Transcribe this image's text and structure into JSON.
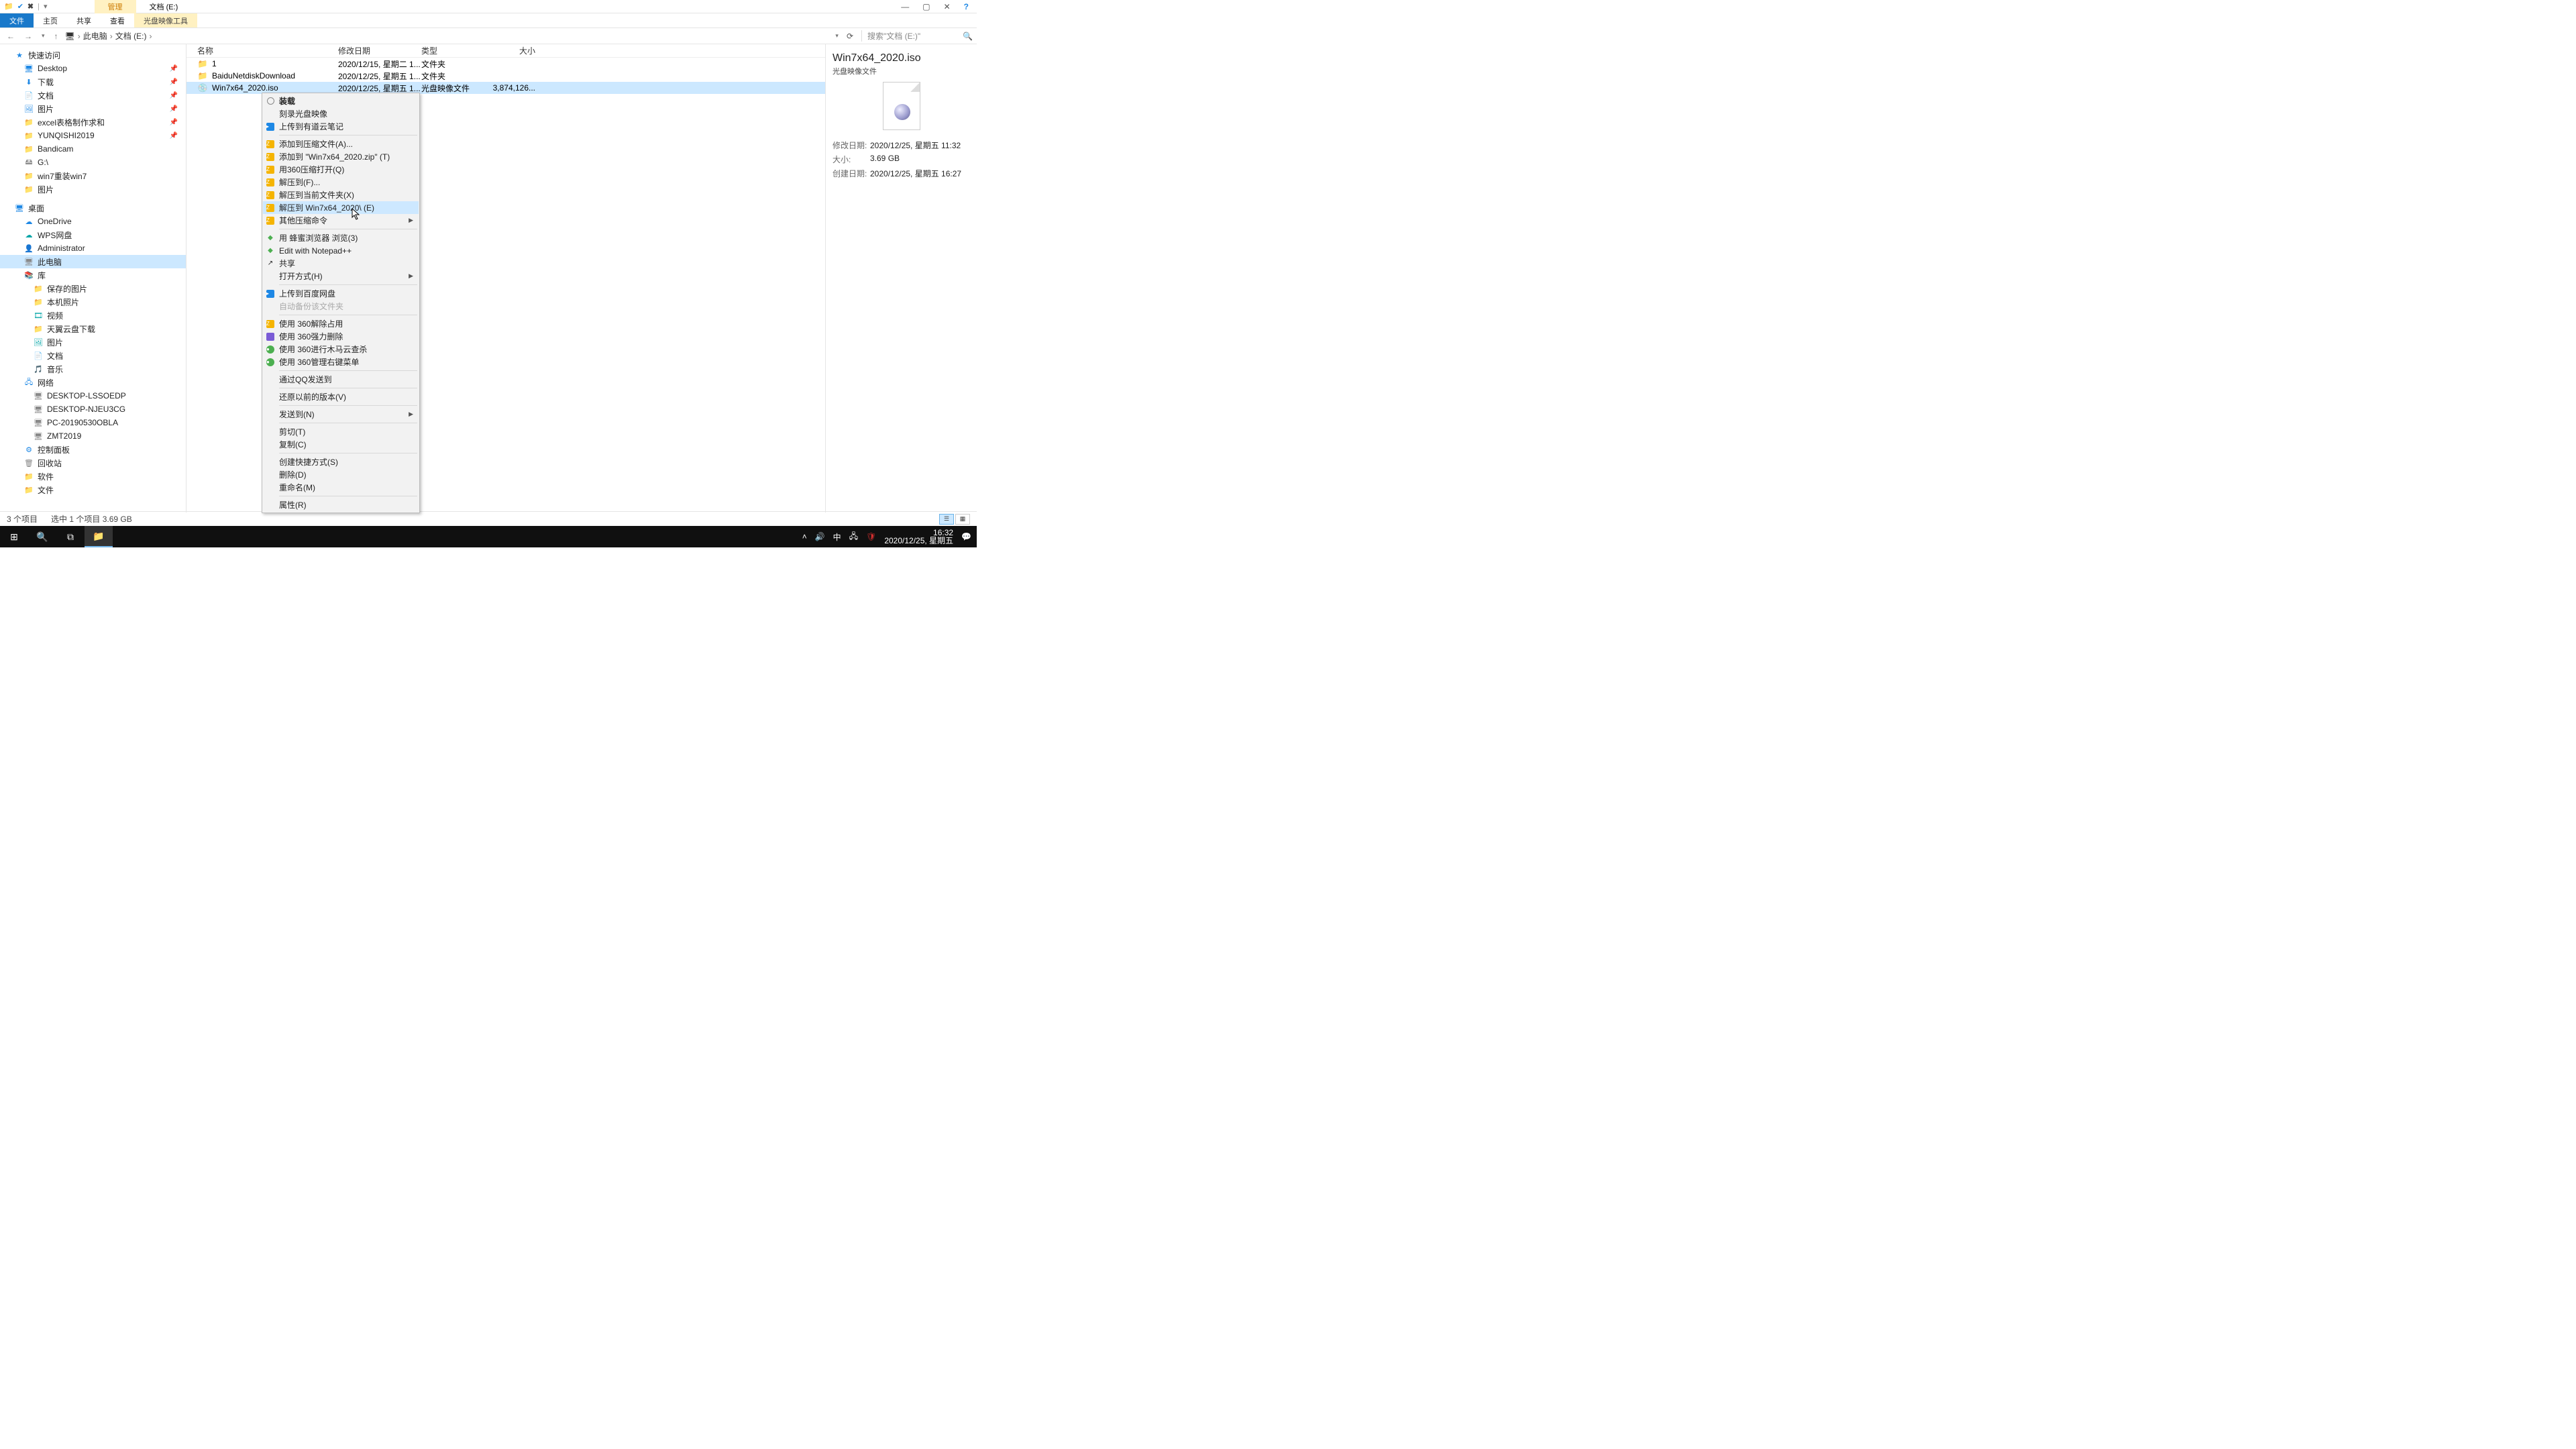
{
  "title": {
    "context_tab": "管理",
    "loc": "文档 (E:)"
  },
  "win_controls": {
    "min": "—",
    "max": "▢",
    "close": "✕",
    "help": "?"
  },
  "ribbon": {
    "tabs": [
      "文件",
      "主页",
      "共享",
      "查看"
    ],
    "context": "光盘映像工具"
  },
  "address": {
    "back": "←",
    "fwd": "→",
    "up": "↑",
    "segments": [
      "此电脑",
      "文档 (E:)"
    ],
    "refresh": "⟳",
    "search_placeholder": "搜索\"文档 (E:)\"",
    "search_icon": "🔍"
  },
  "columns": {
    "name": "名称",
    "date": "修改日期",
    "type": "类型",
    "size": "大小"
  },
  "files": [
    {
      "icon": "📁",
      "name": "1",
      "date": "2020/12/15, 星期二 1...",
      "type": "文件夹",
      "size": ""
    },
    {
      "icon": "📁",
      "name": "BaiduNetdiskDownload",
      "date": "2020/12/25, 星期五 1...",
      "type": "文件夹",
      "size": ""
    },
    {
      "icon": "💿",
      "name": "Win7x64_2020.iso",
      "date": "2020/12/25, 星期五 1...",
      "type": "光盘映像文件",
      "size": "3,874,126..."
    }
  ],
  "context_menu": {
    "highlight_index": 8,
    "groups": [
      [
        {
          "label": "装载",
          "ico": "disc",
          "bold": true
        },
        {
          "label": "刻录光盘映像"
        },
        {
          "label": "上传到有道云笔记",
          "ico": "blue"
        }
      ],
      [
        {
          "label": "添加到压缩文件(A)...",
          "ico": "archive"
        },
        {
          "label": "添加到 \"Win7x64_2020.zip\" (T)",
          "ico": "archive"
        },
        {
          "label": "用360压缩打开(Q)",
          "ico": "archive"
        },
        {
          "label": "解压到(F)...",
          "ico": "archive"
        },
        {
          "label": "解压到当前文件夹(X)",
          "ico": "archive"
        },
        {
          "label": "解压到 Win7x64_2020\\ (E)",
          "ico": "archive"
        },
        {
          "label": "其他压缩命令",
          "ico": "archive",
          "submenu": true
        }
      ],
      [
        {
          "label": "用 蜂蜜浏览器 浏览(3)",
          "ico": "green"
        },
        {
          "label": "Edit with Notepad++",
          "ico": "green"
        },
        {
          "label": "共享",
          "ico": "share"
        },
        {
          "label": "打开方式(H)",
          "submenu": true
        }
      ],
      [
        {
          "label": "上传到百度网盘",
          "ico": "blue"
        },
        {
          "label": "自动备份该文件夹",
          "disabled": true
        }
      ],
      [
        {
          "label": "使用 360解除占用",
          "ico": "archive"
        },
        {
          "label": "使用 360强力删除",
          "ico": "purple"
        },
        {
          "label": "使用 360进行木马云查杀",
          "ico": "360"
        },
        {
          "label": "使用 360管理右键菜单",
          "ico": "360"
        }
      ],
      [
        {
          "label": "通过QQ发送到"
        }
      ],
      [
        {
          "label": "还原以前的版本(V)"
        }
      ],
      [
        {
          "label": "发送到(N)",
          "submenu": true
        }
      ],
      [
        {
          "label": "剪切(T)"
        },
        {
          "label": "复制(C)"
        }
      ],
      [
        {
          "label": "创建快捷方式(S)"
        },
        {
          "label": "删除(D)"
        },
        {
          "label": "重命名(M)"
        }
      ],
      [
        {
          "label": "属性(R)"
        }
      ]
    ]
  },
  "nav_tree": [
    {
      "type": "item",
      "depth": 1,
      "ico": "star",
      "glyph": "★",
      "label": "快速访问"
    },
    {
      "type": "item",
      "depth": 2,
      "ico": "blue",
      "glyph": "🖥",
      "label": "Desktop",
      "pin": true
    },
    {
      "type": "item",
      "depth": 2,
      "ico": "blue",
      "glyph": "⬇",
      "label": "下载",
      "pin": true
    },
    {
      "type": "item",
      "depth": 2,
      "ico": "blue",
      "glyph": "📄",
      "label": "文档",
      "pin": true
    },
    {
      "type": "item",
      "depth": 2,
      "ico": "blue",
      "glyph": "🖼",
      "label": "图片",
      "pin": true
    },
    {
      "type": "item",
      "depth": 2,
      "ico": "yellow",
      "glyph": "📁",
      "label": "excel表格制作求和",
      "pin": true
    },
    {
      "type": "item",
      "depth": 2,
      "ico": "yellow",
      "glyph": "📁",
      "label": "YUNQISHI2019",
      "pin": true
    },
    {
      "type": "item",
      "depth": 2,
      "ico": "yellow",
      "glyph": "📁",
      "label": "Bandicam"
    },
    {
      "type": "item",
      "depth": 2,
      "ico": "gray",
      "glyph": "🖴",
      "label": "G:\\"
    },
    {
      "type": "item",
      "depth": 2,
      "ico": "yellow",
      "glyph": "📁",
      "label": "win7重装win7"
    },
    {
      "type": "item",
      "depth": 2,
      "ico": "yellow",
      "glyph": "📁",
      "label": "图片"
    },
    {
      "type": "sep"
    },
    {
      "type": "item",
      "depth": 1,
      "ico": "blue",
      "glyph": "🖥",
      "label": "桌面"
    },
    {
      "type": "item",
      "depth": 2,
      "ico": "blue",
      "glyph": "☁",
      "label": "OneDrive"
    },
    {
      "type": "item",
      "depth": 2,
      "ico": "teal",
      "glyph": "☁",
      "label": "WPS网盘"
    },
    {
      "type": "item",
      "depth": 2,
      "ico": "gray",
      "glyph": "👤",
      "label": "Administrator"
    },
    {
      "type": "item",
      "depth": 2,
      "ico": "gray",
      "glyph": "🖥",
      "label": "此电脑",
      "selected": true
    },
    {
      "type": "item",
      "depth": 2,
      "ico": "teal",
      "glyph": "📚",
      "label": "库"
    },
    {
      "type": "item",
      "depth": 2,
      "ico": "yellow",
      "glyph": "📁",
      "label": "保存的图片",
      "depth3": true
    },
    {
      "type": "item",
      "depth": 2,
      "ico": "yellow",
      "glyph": "📁",
      "label": "本机照片",
      "depth3": true
    },
    {
      "type": "item",
      "depth": 2,
      "ico": "teal",
      "glyph": "🎞",
      "label": "视频",
      "depth3": true
    },
    {
      "type": "item",
      "depth": 2,
      "ico": "yellow",
      "glyph": "📁",
      "label": "天翼云盘下载",
      "depth3": true
    },
    {
      "type": "item",
      "depth": 2,
      "ico": "teal",
      "glyph": "🖼",
      "label": "图片",
      "depth3": true
    },
    {
      "type": "item",
      "depth": 2,
      "ico": "teal",
      "glyph": "📄",
      "label": "文档",
      "depth3": true
    },
    {
      "type": "item",
      "depth": 2,
      "ico": "teal",
      "glyph": "🎵",
      "label": "音乐",
      "depth3": true
    },
    {
      "type": "item",
      "depth": 2,
      "ico": "blue",
      "glyph": "🖧",
      "label": "网络"
    },
    {
      "type": "item",
      "depth": 2,
      "ico": "gray",
      "glyph": "🖥",
      "label": "DESKTOP-LSSOEDP",
      "depth3": true
    },
    {
      "type": "item",
      "depth": 2,
      "ico": "gray",
      "glyph": "🖥",
      "label": "DESKTOP-NJEU3CG",
      "depth3": true
    },
    {
      "type": "item",
      "depth": 2,
      "ico": "gray",
      "glyph": "🖥",
      "label": "PC-20190530OBLA",
      "depth3": true
    },
    {
      "type": "item",
      "depth": 2,
      "ico": "gray",
      "glyph": "🖥",
      "label": "ZMT2019",
      "depth3": true
    },
    {
      "type": "item",
      "depth": 2,
      "ico": "blue",
      "glyph": "⚙",
      "label": "控制面板"
    },
    {
      "type": "item",
      "depth": 2,
      "ico": "gray",
      "glyph": "🗑",
      "label": "回收站"
    },
    {
      "type": "item",
      "depth": 2,
      "ico": "yellow",
      "glyph": "📁",
      "label": "软件"
    },
    {
      "type": "item",
      "depth": 2,
      "ico": "yellow",
      "glyph": "📁",
      "label": "文件"
    }
  ],
  "details": {
    "title": "Win7x64_2020.iso",
    "sub": "光盘映像文件",
    "rows": [
      {
        "label": "修改日期:",
        "val": "2020/12/25, 星期五 11:32"
      },
      {
        "label": "大小:",
        "val": "3.69 GB"
      },
      {
        "label": "创建日期:",
        "val": "2020/12/25, 星期五 16:27"
      }
    ]
  },
  "statusbar": {
    "count": "3 个项目",
    "selection": "选中 1 个项目  3.69 GB"
  },
  "taskbar": {
    "start": "⊞",
    "search": "🔍",
    "taskview": "⧉",
    "explorer": "📁",
    "tray": {
      "up": "˄",
      "vol": "🔊",
      "ime": "中",
      "net": "🖧",
      "shield": "🛡",
      "notif": "💬"
    },
    "clock": {
      "time": "16:32",
      "date": "2020/12/25, 星期五"
    }
  }
}
